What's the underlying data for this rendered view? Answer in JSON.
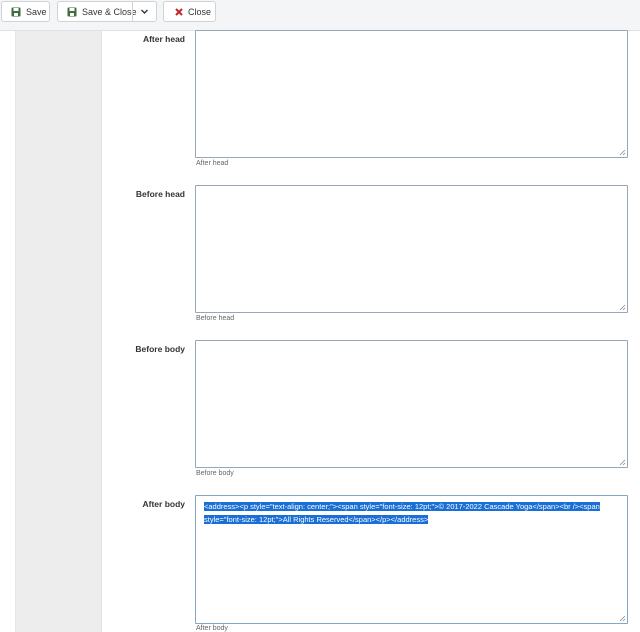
{
  "toolbar": {
    "save_label": "Save",
    "save_close_label": "Save & Close",
    "close_label": "Close"
  },
  "fields": {
    "after_head": {
      "label": "After head",
      "help": "After head",
      "value": ""
    },
    "before_head": {
      "label": "Before head",
      "help": "Before head",
      "value": ""
    },
    "before_body": {
      "label": "Before body",
      "help": "Before body",
      "value": ""
    },
    "after_body": {
      "label": "After body",
      "help": "After body",
      "value_line1": "<address><p style=\"text-align: center;\"><span style=\"font-size: 12pt;\">© 2017-2022 Cascade Yoga</span><br /><span",
      "value_line2": "style=\"font-size: 12pt;\">All Rights Reserved</span></p></address>"
    }
  },
  "colors": {
    "save_icon": "#3b6e3b",
    "close_icon": "#c6242b",
    "selection": "#1a6fd6"
  }
}
